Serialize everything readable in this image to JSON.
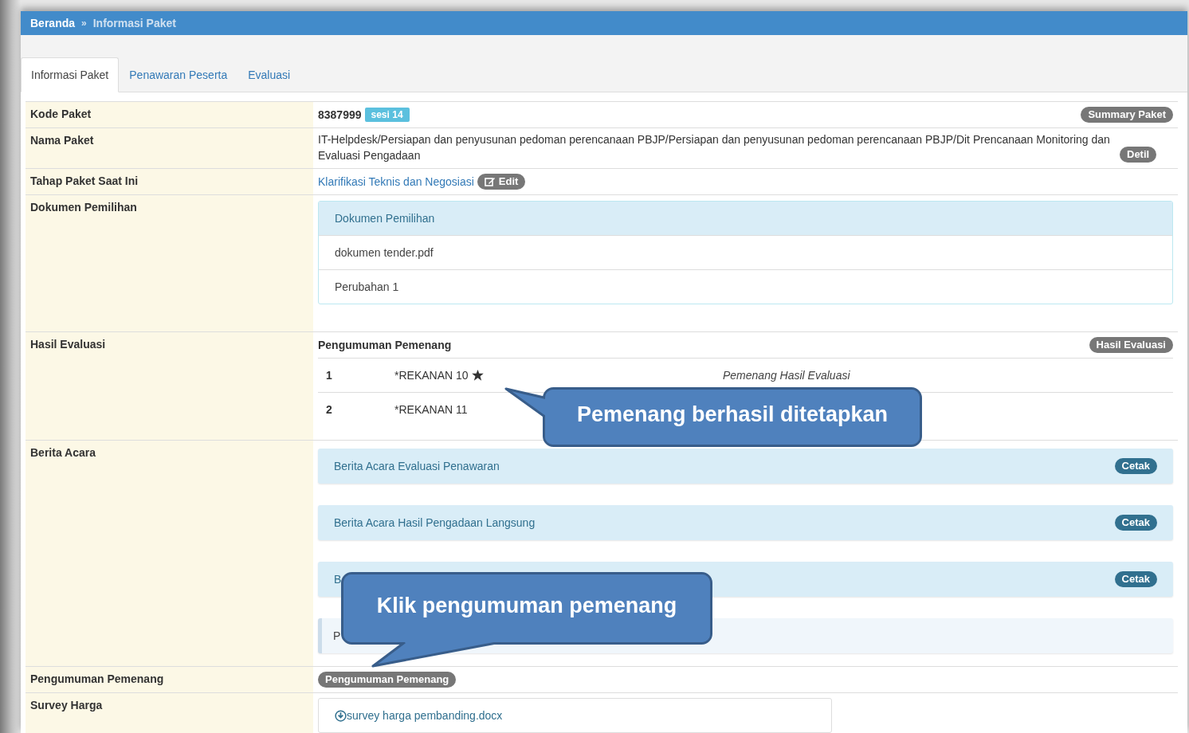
{
  "breadcrumb": [
    {
      "label": "Beranda",
      "current": false
    },
    {
      "label": "Informasi Paket",
      "current": true
    }
  ],
  "breadcrumb_separator": "»",
  "tabs": [
    {
      "label": "Informasi Paket",
      "selected": true
    },
    {
      "label": "Penawaran Peserta",
      "selected": false
    },
    {
      "label": "Evaluasi",
      "selected": false
    }
  ],
  "rows": [
    {
      "label": "Kode Paket",
      "kind": "code",
      "value": "8387999",
      "badge": "sesi 14",
      "button": "Summary Paket"
    },
    {
      "label": "Nama Paket",
      "kind": "text",
      "value": "IT-Helpdesk/Persiapan dan penyusunan pedoman perencanaan PBJP/Persiapan dan penyusunan pedoman perencanaan PBJP/Dit Prencanaan Monitoring dan Evaluasi Pengadaan",
      "button": "Detil"
    },
    {
      "label": "Tahap Paket Saat Ini",
      "kind": "link",
      "value": "Klarifikasi Teknis dan Negosiasi",
      "button": "Edit"
    },
    {
      "label": "Dokumen Pemilihan",
      "kind": "docs",
      "heading": "Dokumen Pemilihan",
      "items": [
        "dokumen tender.pdf",
        "Perubahan 1"
      ]
    },
    {
      "label": "Hasil Evaluasi",
      "kind": "winners",
      "heading": "Pengumuman Pemenang",
      "button": "Hasil Evaluasi",
      "winners": [
        {
          "no": "1",
          "name": "*REKANAN 10",
          "winner": true,
          "note": "Pemenang Hasil Evaluasi"
        },
        {
          "no": "2",
          "name": "*REKANAN 11",
          "winner": false
        }
      ]
    },
    {
      "label": "Berita Acara",
      "kind": "reports",
      "items": [
        {
          "title": "Berita Acara Evaluasi Penawaran",
          "button": "Cetak"
        },
        {
          "title": "Berita Acara Hasil Pengadaan Langsung",
          "button": "Cetak"
        },
        {
          "title": "B",
          "button": "Cetak"
        },
        {
          "title": "P"
        }
      ]
    },
    {
      "label": "Pengumuman Pemenang",
      "kind": "button",
      "button": "Pengumuman Pemenang"
    },
    {
      "label": "Survey Harga",
      "kind": "file",
      "value": "survey harga pembanding.docx"
    }
  ],
  "callouts": [
    {
      "text": "Pemenang berhasil ditetapkan"
    },
    {
      "text": "Klik pengumuman pemenang"
    }
  ]
}
